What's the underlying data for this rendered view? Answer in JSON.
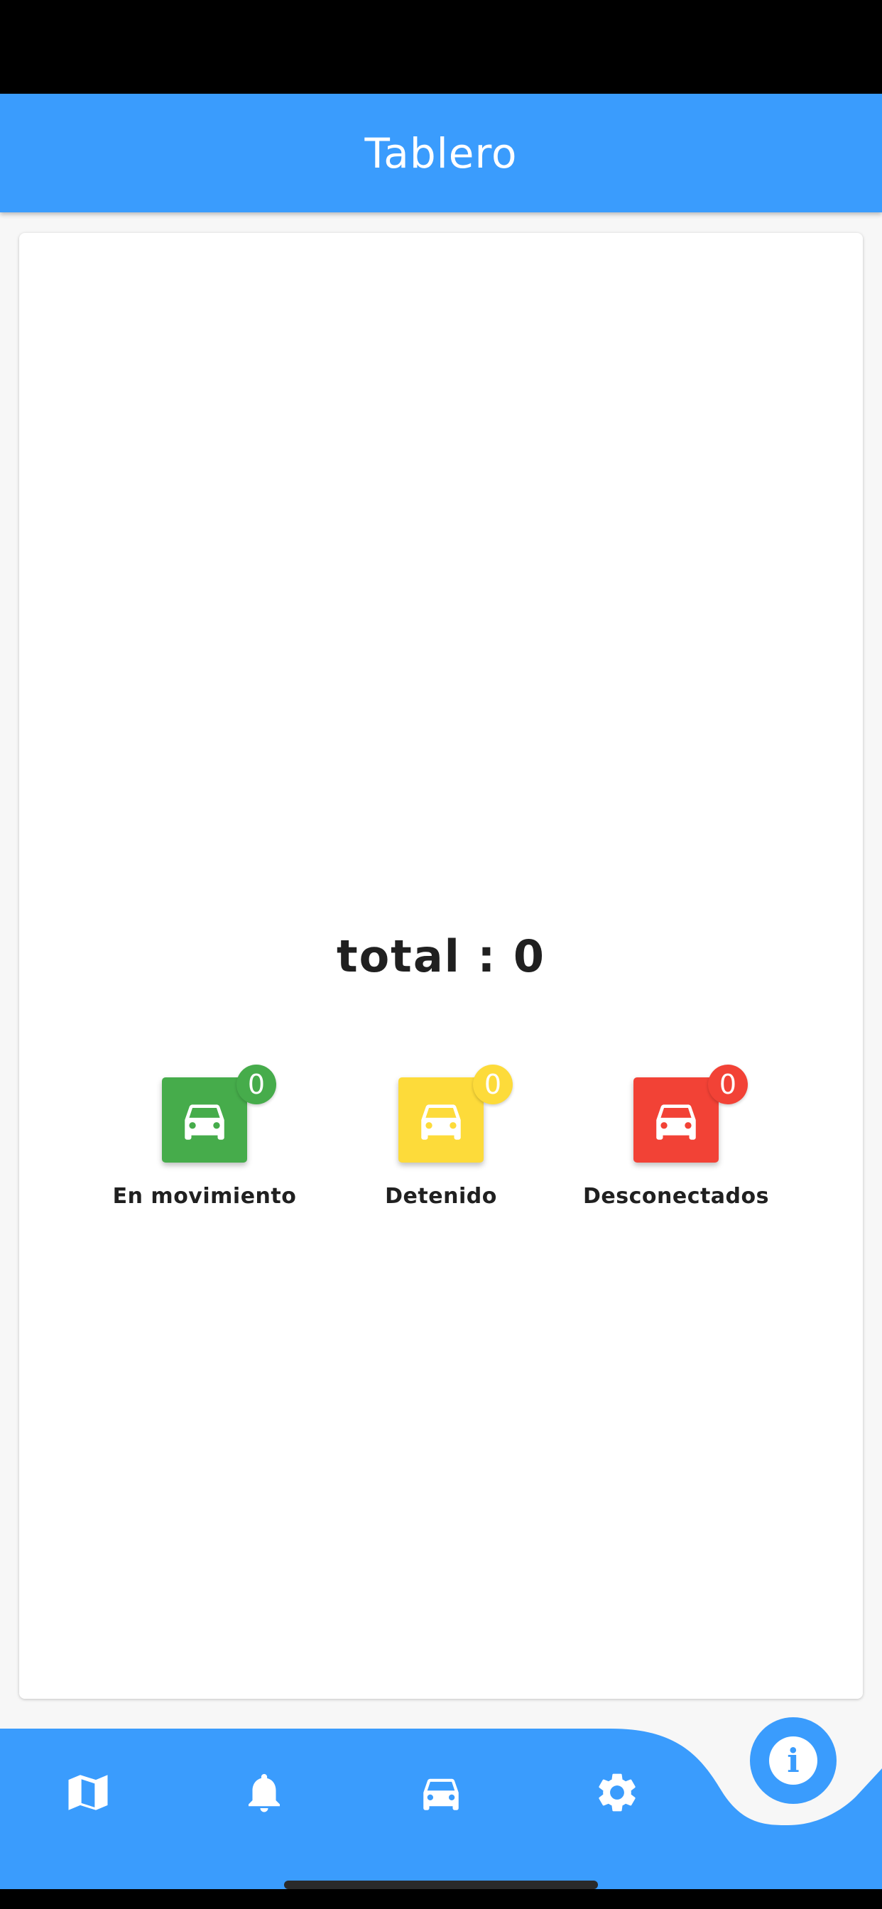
{
  "app_bar": {
    "title": "Tablero"
  },
  "summary": {
    "total_text": "total : 0"
  },
  "statuses": [
    {
      "label": "En movimiento",
      "count": "0",
      "color": "#46ac4b"
    },
    {
      "label": "Detenido",
      "count": "0",
      "color": "#fddb3a"
    },
    {
      "label": "Desconectados",
      "count": "0",
      "color": "#f24236"
    }
  ],
  "bottom_nav": {
    "items": [
      {
        "icon": "map-icon"
      },
      {
        "icon": "bell-icon"
      },
      {
        "icon": "car-icon"
      },
      {
        "icon": "gear-icon"
      }
    ],
    "fab_icon": "info-icon"
  },
  "colors": {
    "primary": "#3a9cfd",
    "background": "#f7f7f7",
    "card": "#ffffff"
  }
}
